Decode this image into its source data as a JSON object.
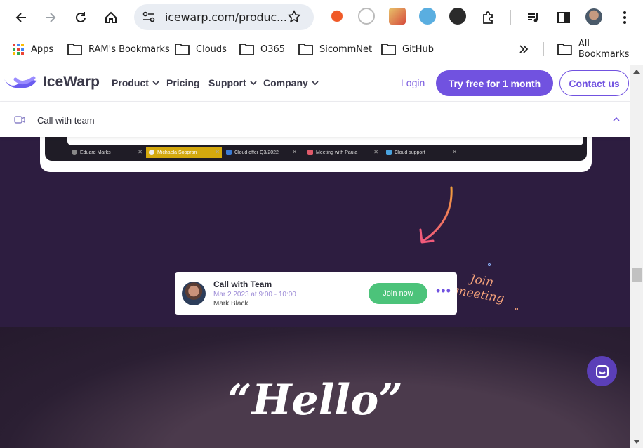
{
  "browser": {
    "url": "icewarp.com/produc...",
    "bookmarks": [
      "Apps",
      "RAM's Bookmarks",
      "Clouds",
      "O365",
      "SicommNet",
      "GitHub"
    ],
    "all_bookmarks": "All Bookmarks"
  },
  "site": {
    "logo": "IceWarp",
    "nav": [
      "Product",
      "Pricing",
      "Support",
      "Company"
    ],
    "login": "Login",
    "try_free": "Try free for 1 month",
    "contact": "Contact us",
    "subnav_label": "Call with team"
  },
  "mini_tabs": [
    "Eduard Marks",
    "Michaela Soppran",
    "Cloud offer Q3/2022",
    "Meeting with Paula",
    "Cloud support"
  ],
  "join_note": [
    "Join",
    "meeting"
  ],
  "call_card": {
    "title": "Call with Team",
    "date": "Mar 2 2023 at 9:00 - 10:00",
    "host": "Mark Black",
    "join": "Join now"
  },
  "hello": "“Hello”",
  "colors": {
    "accent": "#7152e0",
    "join_green": "#4cc37a",
    "dark_bg": "#2d1d40"
  }
}
